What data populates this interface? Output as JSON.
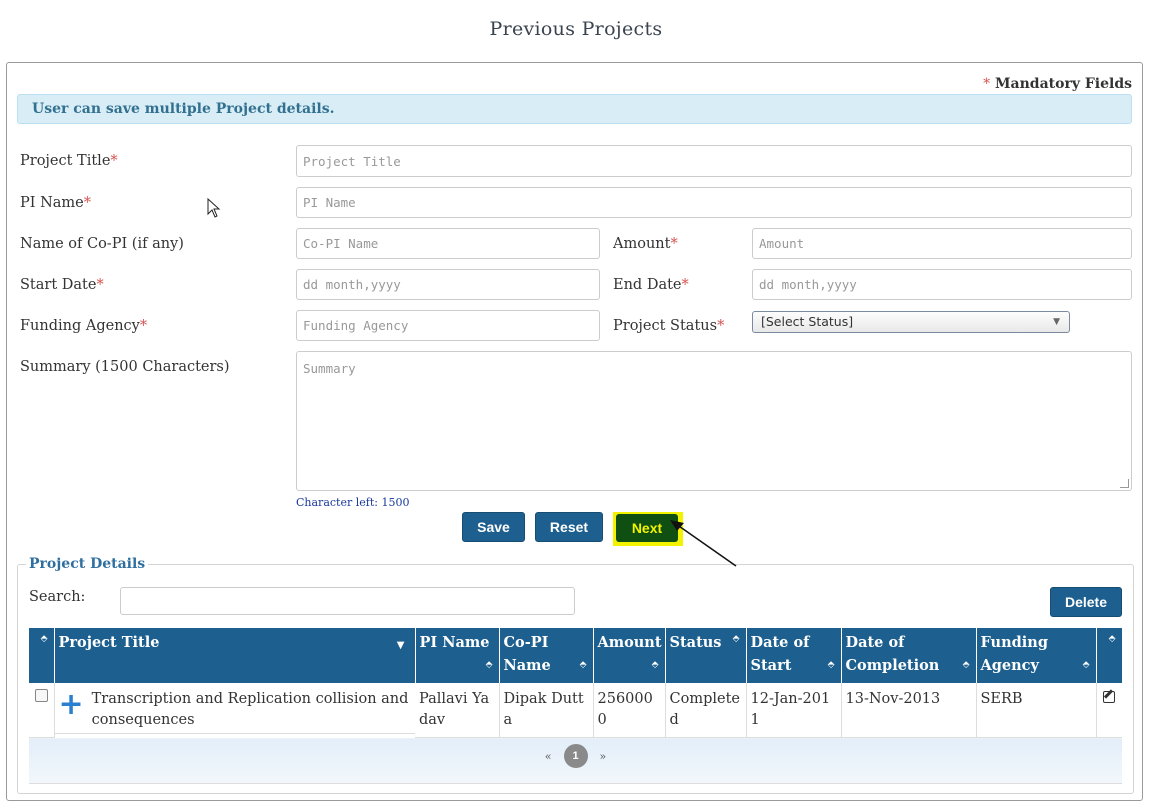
{
  "page": {
    "title": "Previous Projects"
  },
  "form": {
    "mandatory_label": "Mandatory Fields",
    "mandatory_marker": "*",
    "info_message": "User can save multiple Project details.",
    "fields": {
      "project_title": {
        "label": "Project Title",
        "placeholder": "Project Title",
        "value": ""
      },
      "pi_name": {
        "label": "PI Name",
        "placeholder": "PI Name",
        "value": ""
      },
      "co_pi": {
        "label": "Name of Co-PI (if any)",
        "placeholder": "Co-PI Name",
        "value": ""
      },
      "amount": {
        "label": "Amount",
        "placeholder": "Amount",
        "value": ""
      },
      "start_date": {
        "label": "Start Date",
        "placeholder": "dd month,yyyy",
        "value": ""
      },
      "end_date": {
        "label": "End Date",
        "placeholder": "dd month,yyyy",
        "value": ""
      },
      "funding_agency": {
        "label": "Funding Agency",
        "placeholder": "Funding Agency",
        "value": ""
      },
      "project_status": {
        "label": "Project Status",
        "selected": "[Select Status]"
      },
      "summary": {
        "label": "Summary (1500 Characters)",
        "placeholder": "Summary",
        "value": ""
      }
    },
    "char_left": "Character left: 1500",
    "buttons": {
      "save": "Save",
      "reset": "Reset",
      "next": "Next"
    }
  },
  "project_details": {
    "legend": "Project Details",
    "search_label": "Search:",
    "search_value": "",
    "delete_label": "Delete",
    "columns": [
      "Project Title",
      "PI Name",
      "Co-PI Name",
      "Amount",
      "Status",
      "Date of Start",
      "Date of Completion",
      "Funding Agency"
    ],
    "rows": [
      {
        "project_title": "Transcription and Replication collision and consequences",
        "pi_name": "Pallavi Yadav",
        "co_pi_name": "Dipak Dutta",
        "amount": "2560000",
        "status": "Completed",
        "date_of_start": "12-Jan-2011",
        "date_of_completion": "13-Nov-2013",
        "funding_agency": "SERB"
      }
    ],
    "pagination": {
      "prev": "«",
      "current": "1",
      "next": "»"
    }
  },
  "colors": {
    "primary_button": "#1d5f8e",
    "next_button": "#0f4f12",
    "highlight": "#f3f300",
    "info_bg": "#d9edf7"
  },
  "icons": [
    "sort-icon",
    "sort-desc-icon",
    "expand-plus-icon",
    "edit-icon",
    "checkbox",
    "mouse-cursor-icon",
    "annotation-arrow"
  ]
}
